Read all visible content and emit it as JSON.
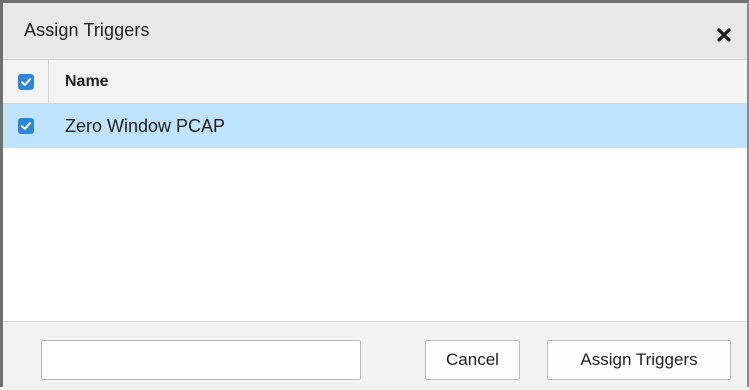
{
  "dialog": {
    "title": "Assign Triggers",
    "close_icon": "close-icon"
  },
  "table": {
    "columns": [
      "Name"
    ],
    "select_all_checked": true,
    "rows": [
      {
        "name": "Zero Window PCAP",
        "checked": true,
        "selected": true
      }
    ]
  },
  "footer": {
    "filter_value": "",
    "filter_placeholder": "",
    "cancel_label": "Cancel",
    "assign_label": "Assign Triggers"
  },
  "colors": {
    "titlebar_bg": "#e8e8e8",
    "checkbox_blue": "#2f86d9",
    "selected_row_bg": "#bfe3fb",
    "footer_bg": "#f2f2f2"
  }
}
